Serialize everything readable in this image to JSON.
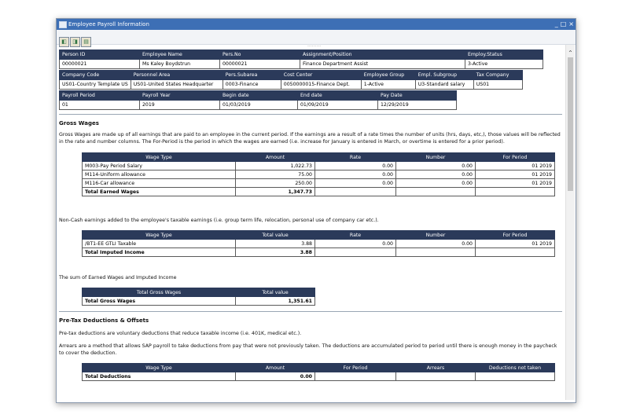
{
  "window": {
    "title": "Employee Payroll Information"
  },
  "header_row1": {
    "labels": [
      "Person ID",
      "Employee Name",
      "Pers.No",
      "Assignment/Position",
      "Employ.Status"
    ],
    "values": [
      "00000021",
      "Ms Kaley Boydstrun",
      "00000021",
      "Finance Department Assist",
      "3-Active"
    ]
  },
  "header_row2": {
    "labels": [
      "Company Code",
      "Personnel Area",
      "Pers.Subarea",
      "Cost Center",
      "Employee Group",
      "Empl. Subgroup",
      "Tax Company"
    ],
    "values": [
      "US01-Country Template US",
      "US01-United States Headquarter",
      "0003-Finance",
      "0050000015-Finance Dept.",
      "1-Active",
      "U3-Standard salary",
      "US01"
    ]
  },
  "header_row3": {
    "labels": [
      "Payroll Period",
      "Payroll Year",
      "Begin date",
      "End date",
      "Pay Date"
    ],
    "values": [
      "01",
      "2019",
      "01/03/2019",
      "01/09/2019",
      "12/29/2019"
    ]
  },
  "gross": {
    "title": "Gross Wages",
    "desc": "Gross Wages are made up of all earnings that are paid to an employee in the current period. If the earnings are a result of a rate times the number of units (hrs, days, etc,), those values will be reflected in the rate and number columns. The For-Period is the period in which the wages are earned (i.e. increase for January is entered in March, or overtime is entered for a prior period).",
    "columns": [
      "Wage Type",
      "Amount",
      "Rate",
      "Number",
      "For Period"
    ],
    "rows": [
      [
        "M003-Pay Period Salary",
        "1,022.73",
        "0.00",
        "0.00",
        "01 2019"
      ],
      [
        "M114-Uniform allowance",
        "75.00",
        "0.00",
        "0.00",
        "01 2019"
      ],
      [
        "M116-Car allowance",
        "250.00",
        "0.00",
        "0.00",
        "01 2019"
      ]
    ],
    "total": [
      "Total Earned Wages",
      "1,347.73"
    ]
  },
  "imputed": {
    "desc": "Non-Cash earnings added to the employee's taxable earnings (i.e. group term life, relocation, personal use of company car etc.).",
    "columns": [
      "Wage Type",
      "Total value",
      "Rate",
      "Number",
      "For Period"
    ],
    "rows": [
      [
        "/BT1-EE GTLI Taxable",
        "3.88",
        "0.00",
        "0.00",
        "01 2019"
      ]
    ],
    "total": [
      "Total Imputed Income",
      "3.88"
    ]
  },
  "sum": {
    "desc": "The sum of Earned Wages and Imputed Income",
    "columns": [
      "Total Gross Wages",
      "Total value"
    ],
    "total": [
      "Total Gross Wages",
      "1,351.61"
    ]
  },
  "pretax": {
    "title": "Pre-Tax Deductions & Offsets",
    "desc1": "Pre-tax deductions are voluntary deductions that reduce taxable income (i.e. 401K, medical etc.).",
    "desc2": "Arrears are a method that allows SAP payroll to take deductions from pay that were not previously taken. The deductions are accumulated period to period until there is enough money in the paycheck to cover the deduction.",
    "columns": [
      "Wage Type",
      "Amount",
      "For Period",
      "Arrears",
      "Deductions not taken"
    ],
    "total": [
      "Total Deductions",
      "0.00"
    ]
  }
}
